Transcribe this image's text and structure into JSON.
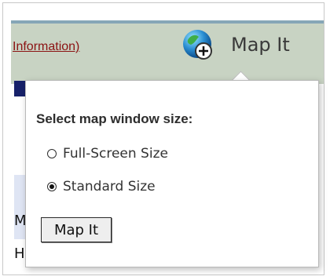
{
  "header": {
    "info_link": "Information)",
    "title": "Map It",
    "icon": "globe-search-icon"
  },
  "underlay": {
    "letter_m": "M",
    "letter_h": "H"
  },
  "popup": {
    "title": "Select map window size:",
    "options": [
      {
        "label": "Full-Screen Size",
        "checked": false
      },
      {
        "label": "Standard Size",
        "checked": true
      }
    ],
    "button": "Map It"
  },
  "colors": {
    "header_bg": "#c8d3c3",
    "header_top": "#86a6b7",
    "link": "#8b1212",
    "accent_dark": "#17216a",
    "accent_light": "#dfe5f4"
  }
}
